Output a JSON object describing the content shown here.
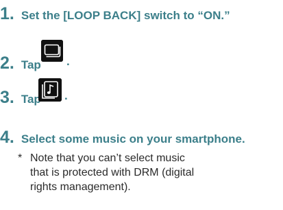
{
  "steps": [
    {
      "number": "1.",
      "text": "Set the [LOOP BACK] switch to “ON.”"
    },
    {
      "number": "2.",
      "text": "Tap",
      "suffix": "."
    },
    {
      "number": "3.",
      "text": "Tap",
      "suffix": "."
    },
    {
      "number": "4.",
      "text": "Select some music on your smartphone."
    }
  ],
  "icons": {
    "screens": "screens-icon",
    "music": "music-note-icon"
  },
  "note": {
    "marker": "*",
    "text": "Note that you can’t select music that is protected with DRM (digital rights management)."
  },
  "colors": {
    "step_teal": "#3c7f8a",
    "icon_bg": "#111111",
    "note_text": "#2a2a2a"
  }
}
